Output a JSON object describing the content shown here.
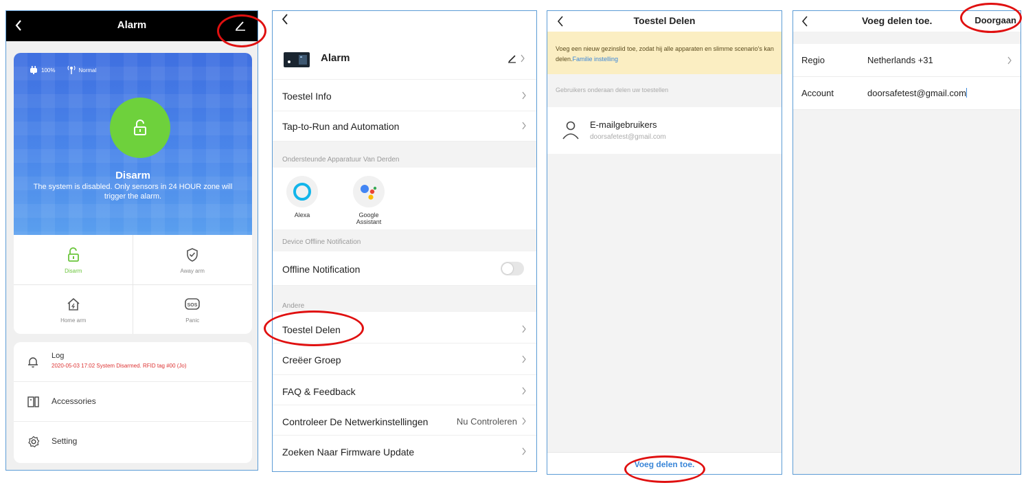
{
  "alarm_screen": {
    "title": "Alarm",
    "battery": "100%",
    "signal": "Normal",
    "state_title": "Disarm",
    "state_desc": "The system is disabled. Only sensors in 24 HOUR zone will trigger the alarm.",
    "modes": [
      {
        "label": "Disarm"
      },
      {
        "label": "Away arm"
      },
      {
        "label": "Home arm"
      },
      {
        "label": "Panic"
      }
    ],
    "log_label": "Log",
    "log_entry": "2020-05-03 17:02 System Disarmed.  RFID tag #00 (Jo)",
    "accessories_label": "Accessories",
    "setting_label": "Setting"
  },
  "settings_screen": {
    "device_name": "Alarm",
    "items": {
      "device_info": "Toestel Info",
      "tap_to_run": "Tap-to-Run and Automation",
      "third_party_header": "Ondersteunde Apparatuur Van Derden",
      "alexa": "Alexa",
      "google_line1": "Google",
      "google_line2": "Assistant",
      "offline_header": "Device Offline Notification",
      "offline_label": "Offline Notification",
      "other_header": "Andere",
      "share_device": "Toestel Delen",
      "create_group": "Creëer Groep",
      "faq": "FAQ & Feedback",
      "check_network": "Controleer De Netwerkinstellingen",
      "check_now": "Nu Controleren",
      "firmware": "Zoeken Naar Firmware Update"
    },
    "offline_notification_on": false
  },
  "share_screen": {
    "title": "Toestel Delen",
    "banner_text": "Voeg een nieuw gezinslid toe, zodat hij alle apparaten en slimme scenario's kan delen.",
    "banner_link": "Familie instelling",
    "section_label": "Gebruikers onderaan delen uw toestellen",
    "user_name": "E-mailgebruikers",
    "user_email": "doorsafetest@gmail.com",
    "footer_button": "Voeg delen toe."
  },
  "add_share_screen": {
    "title": "Voeg delen toe.",
    "action": "Doorgaan",
    "region_label": "Regio",
    "region_value": "Netherlands +31",
    "account_label": "Account",
    "account_value": "doorsafetest@gmail.com"
  },
  "colors": {
    "accent_green": "#6ed13c",
    "link_blue": "#3a86d8",
    "highlight_red": "#e01010",
    "hero_blue": "#4a86ea"
  }
}
